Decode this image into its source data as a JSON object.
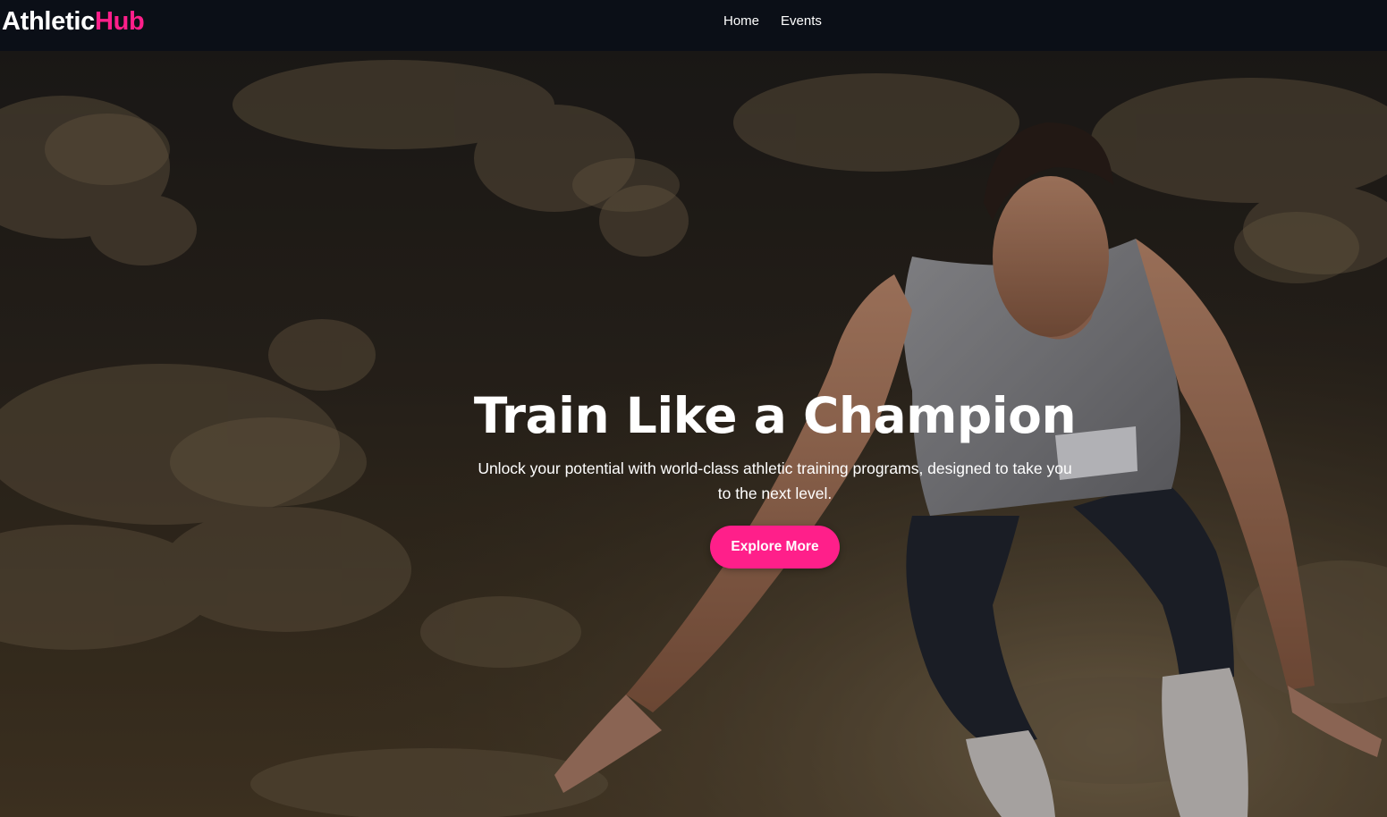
{
  "brand": {
    "name_part1": "Athletic",
    "name_part2": "Hub",
    "accent_color": "#ff1f8a"
  },
  "nav": {
    "items": [
      {
        "label": "Home"
      },
      {
        "label": "Events"
      }
    ]
  },
  "hero": {
    "title": "Train Like a Champion",
    "subtitle": "Unlock your potential with world-class athletic training programs, designed to take you to the next level.",
    "button_label": "Explore More",
    "background_image": "athlete-jumping-cloudy-sky"
  },
  "colors": {
    "navbar_bg": "#0b0f17",
    "text": "#ffffff",
    "button_bg": "#ff1f8a"
  }
}
